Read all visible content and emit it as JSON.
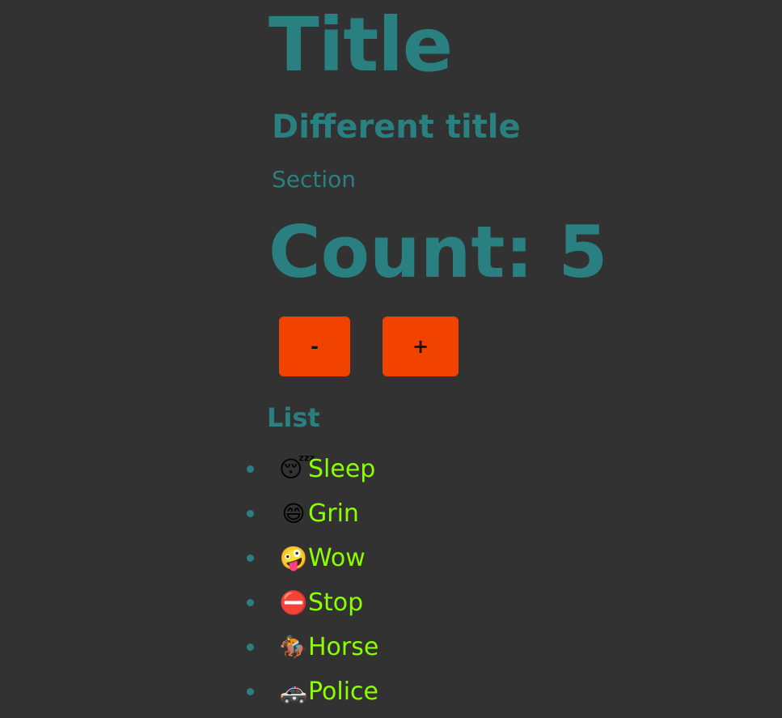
{
  "header": {
    "title": "Title",
    "subtitle": "Different title",
    "section": "Section"
  },
  "counter": {
    "display": "Count: 5",
    "decrement_label": "-",
    "increment_label": "+"
  },
  "list": {
    "heading": "List",
    "items": [
      {
        "emoji": "😴",
        "label": "Sleep",
        "icon": "sleeping-face-icon"
      },
      {
        "emoji": "😄",
        "label": "Grin",
        "icon": "grinning-face-icon"
      },
      {
        "emoji": "🤪",
        "label": "Wow",
        "icon": "zany-face-icon"
      },
      {
        "emoji": "⛔",
        "label": "Stop",
        "icon": "no-entry-icon"
      },
      {
        "emoji": "🏇",
        "label": "Horse",
        "icon": "horse-racing-icon"
      },
      {
        "emoji": "🚓",
        "label": "Police",
        "icon": "police-car-icon"
      }
    ]
  },
  "colors": {
    "background": "#323232",
    "heading": "#2a8080",
    "button": "#f24200",
    "list_text": "#8aff00"
  }
}
